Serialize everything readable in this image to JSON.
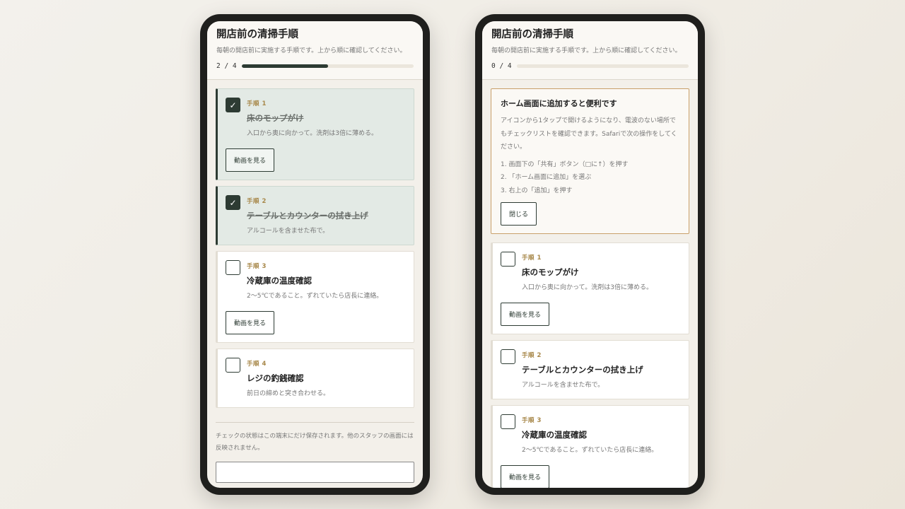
{
  "app": {
    "title": "開店前の清掃手順",
    "description": "毎朝の開店前に実施する手順です。上から順に確認してください。"
  },
  "left_phone": {
    "progress_text": "2 / 4",
    "progress_fraction": 0.5,
    "steps": [
      {
        "label": "手順 1",
        "title": "床のモップがけ",
        "description": "入口から奥に向かって。洗剤は3倍に薄める。",
        "checked": true,
        "video_label": "動画を見る"
      },
      {
        "label": "手順 2",
        "title": "テーブルとカウンターの拭き上げ",
        "description": "アルコールを含ませた布で。",
        "checked": true
      },
      {
        "label": "手順 3",
        "title": "冷蔵庫の温度確認",
        "description": "2〜5℃であること。ずれていたら店長に連絡。",
        "checked": false,
        "video_label": "動画を見る"
      },
      {
        "label": "手順 4",
        "title": "レジの釣銭確認",
        "description": "前日の締めと突き合わせる。",
        "checked": false
      }
    ],
    "footer_note": "チェックの状態はこの端末にだけ保存されます。他のスタッフの画面には反映されません。"
  },
  "right_phone": {
    "progress_text": "0 / 4",
    "progress_fraction": 0,
    "install_prompt": {
      "title": "ホーム画面に追加すると便利です",
      "description": "アイコンから1タップで開けるようになり、電波のない場所でもチェックリストを確認できます。Safariで次の操作をしてください。",
      "steps": [
        "1. 画面下の「共有」ボタン（□に↑）を押す",
        "2. 「ホーム画面に追加」を選ぶ",
        "3. 右上の「追加」を押す"
      ],
      "close_label": "閉じる"
    },
    "steps": [
      {
        "label": "手順 1",
        "title": "床のモップがけ",
        "description": "入口から奥に向かって。洗剤は3倍に薄める。",
        "checked": false,
        "video_label": "動画を見る"
      },
      {
        "label": "手順 2",
        "title": "テーブルとカウンターの拭き上げ",
        "description": "アルコールを含ませた布で。",
        "checked": false
      },
      {
        "label": "手順 3",
        "title": "冷蔵庫の温度確認",
        "description": "2〜5℃であること。ずれていたら店長に連絡。",
        "checked": false,
        "video_label": "動画を見る"
      }
    ]
  },
  "colors": {
    "accent": "#2d3b33",
    "step_label": "#a8884a",
    "done_bg": "#e3eae5",
    "install_border": "#c9a06a"
  },
  "icons": {
    "checked": "check-icon"
  }
}
